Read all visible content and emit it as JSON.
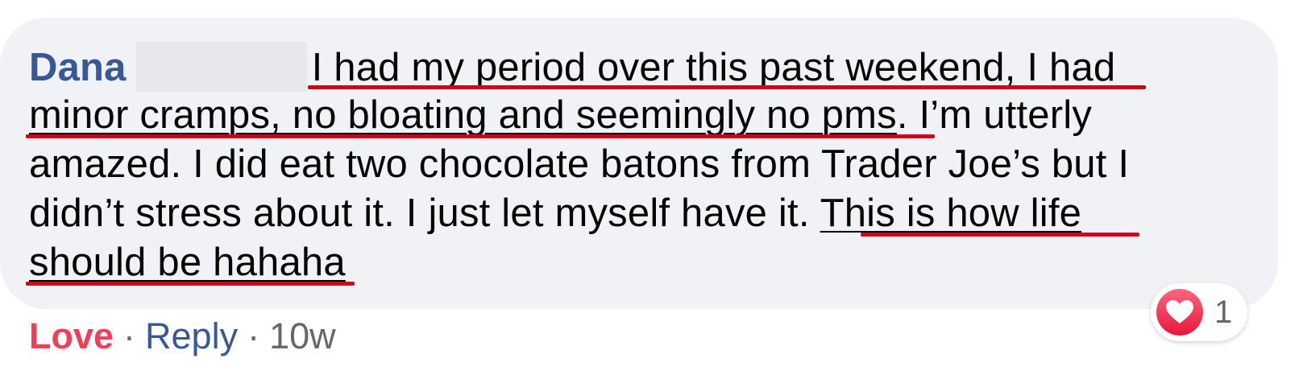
{
  "comment": {
    "author": "Dana",
    "lines": [
      {
        "pre": "I had my period over this past weekend, I had",
        "post": ""
      },
      {
        "pre": "minor cramps, no bloating and seemingly no pms",
        "post": ". I’m utterly"
      },
      {
        "pre": "amazed. I did eat two chocolate batons from Trader Joe’s but I",
        "post": ""
      },
      {
        "pre": "didn’t stress about it. I just let myself have it. ",
        "highlight": "This is how life"
      },
      {
        "pre": "should be hahaha",
        "post": ""
      }
    ]
  },
  "actions": {
    "love_label": "Love",
    "separator": "·",
    "reply_label": "Reply",
    "timestamp": "10w"
  },
  "reactions": {
    "icon": "heart-icon",
    "count": "1",
    "color": "#f33e58"
  },
  "annotation_color": "#d0021b"
}
